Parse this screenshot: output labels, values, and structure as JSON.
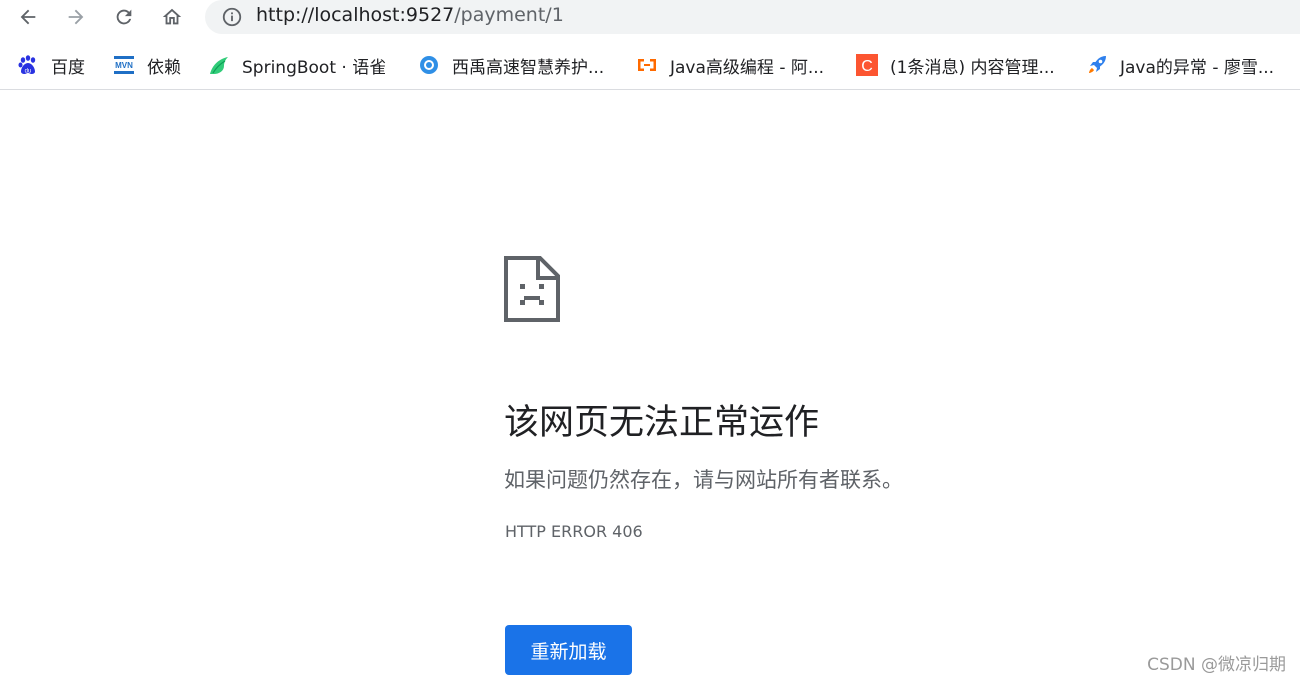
{
  "nav": {
    "back_icon": "arrow-left-icon",
    "forward_icon": "arrow-right-icon",
    "reload_icon": "reload-icon",
    "home_icon": "home-icon",
    "info_icon": "info-circle-icon",
    "url_host": "http://localhost:9527",
    "url_path": "/payment/1"
  },
  "bookmarks": [
    {
      "label": "百度",
      "icon": "baidu-paw-icon",
      "color": "#2932e1"
    },
    {
      "label": "依赖",
      "icon": "mvn-icon",
      "color": "#1f6fc5"
    },
    {
      "label": "SpringBoot · 语雀",
      "icon": "yuque-bird-icon",
      "color": "#31cc79"
    },
    {
      "label": "西禹高速智慧养护...",
      "icon": "circle-e-icon",
      "color": "#2f8fe6"
    },
    {
      "label": "Java高级编程 - 阿...",
      "icon": "aliyun-icon",
      "color": "#ff6a00"
    },
    {
      "label": "(1条消息) 内容管理...",
      "icon": "csdn-c-icon",
      "color": "#fc5531"
    },
    {
      "label": "Java的异常 - 廖雪...",
      "icon": "rocket-icon",
      "color": "#2f80ed"
    }
  ],
  "error": {
    "title": "该网页无法正常运作",
    "description": "如果问题仍然存在，请与网站所有者联系。",
    "code": "HTTP ERROR 406",
    "reload_label": "重新加载",
    "icon": "sad-document-icon"
  },
  "watermark": "CSDN @微凉归期",
  "colors": {
    "accent": "#1a73e8",
    "text_primary": "#202124",
    "text_secondary": "#5f6368",
    "omnibox_bg": "#f1f3f4"
  }
}
